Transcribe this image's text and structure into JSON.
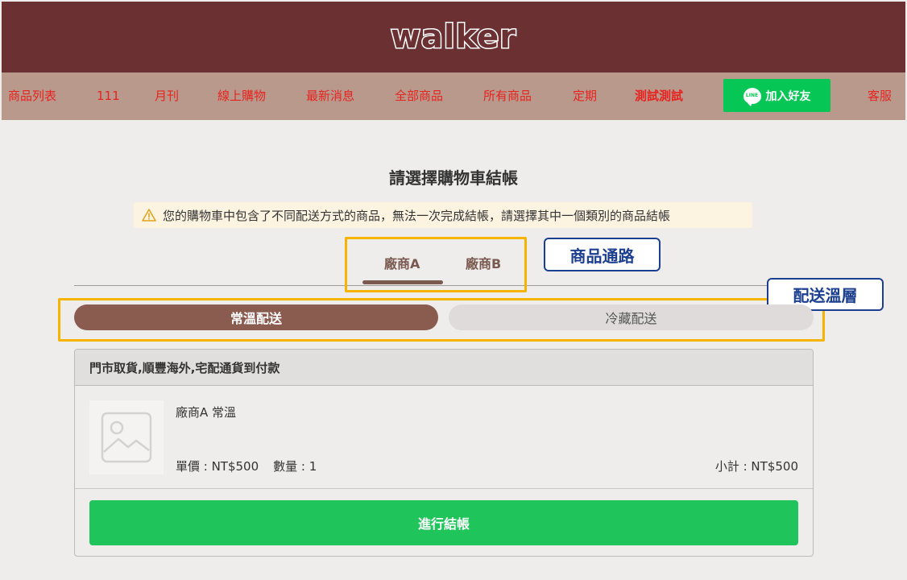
{
  "header": {
    "logo": "walker"
  },
  "nav": {
    "items": [
      {
        "label": "商品列表"
      },
      {
        "label": "111"
      },
      {
        "label": "月刊"
      },
      {
        "label": "線上購物"
      },
      {
        "label": "最新消息"
      },
      {
        "label": "全部商品"
      },
      {
        "label": "所有商品"
      },
      {
        "label": "定期"
      },
      {
        "label": "測試測試"
      }
    ],
    "line_button": {
      "icon_text": "LINE",
      "label": "加入好友"
    },
    "service": "客服"
  },
  "page": {
    "title": "請選擇購物車結帳",
    "warning": "您的購物車中包含了不同配送方式的商品，無法一次完成結帳，請選擇其中一個類別的商品結帳"
  },
  "vendor_tabs": [
    {
      "label": "廠商A",
      "active": true
    },
    {
      "label": "廠商B",
      "active": false
    }
  ],
  "annotations": {
    "channel_label": "商品通路",
    "temperature_label": "配送溫層",
    "box_color": "#f6b400",
    "label_color": "#1c3f8f"
  },
  "temperature_tabs": [
    {
      "label": "常溫配送",
      "active": true
    },
    {
      "label": "冷藏配送",
      "active": false
    }
  ],
  "cart": {
    "shipping_methods": "門市取貨,順豐海外,宅配通貨到付款",
    "item": {
      "name": "廠商A 常溫",
      "unit_price": "單價 : NT$500",
      "quantity": "數量 : 1",
      "subtotal": "小計 : NT$500"
    },
    "checkout_label": "進行結帳"
  },
  "colors": {
    "header_bg": "#6b3032",
    "nav_bg": "#b8998c",
    "nav_text": "#e8231f",
    "line_green": "#06c755",
    "checkout_green": "#1fc45a",
    "active_tab": "#8a5b4f"
  }
}
